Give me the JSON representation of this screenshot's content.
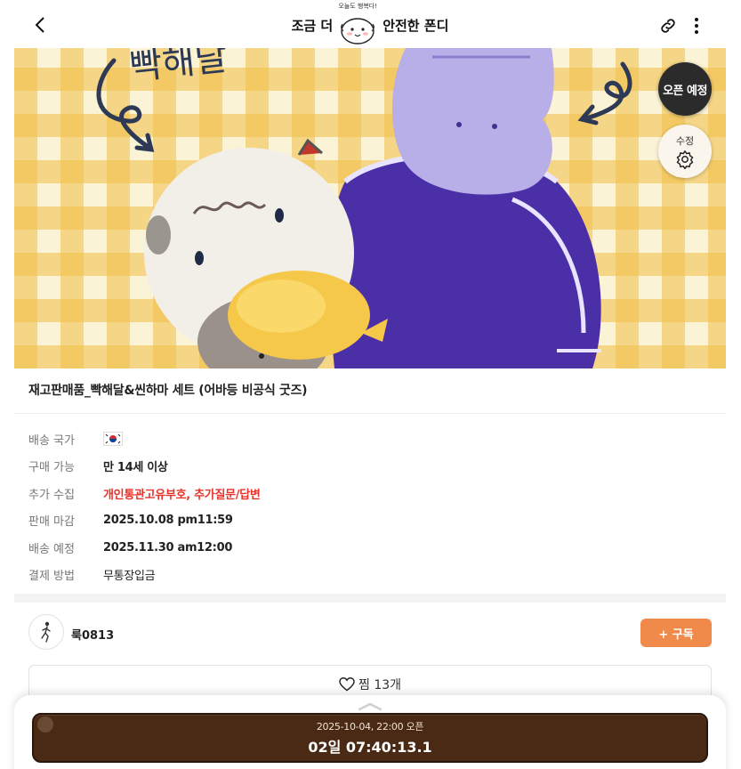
{
  "header": {
    "brand_left": "조금 더",
    "brand_right": "안전한 폰디",
    "mascot_tagline": "오늘도 행복다!",
    "icons": [
      "chevron-left-icon",
      "link-icon",
      "more-vertical-icon"
    ]
  },
  "hero": {
    "caption_handwriting": "빡해달",
    "open_badge": "오픈 예정",
    "edit_label": "수정"
  },
  "product": {
    "title": "재고판매품_빡해달&씬하마 세트 (어바등 비공식 굿즈)"
  },
  "info": [
    {
      "label": "배송 국가",
      "value": "",
      "type": "flag"
    },
    {
      "label": "구매 가능",
      "value": "만 14세 이상",
      "type": "bold"
    },
    {
      "label": "추가 수집",
      "value": "개인통관고유부호, 추가질문/답변",
      "type": "red"
    },
    {
      "label": "판매 마감",
      "value": "2025.10.08 pm11:59",
      "type": "bold"
    },
    {
      "label": "배송 예정",
      "value": "2025.11.30 am12:00",
      "type": "bold"
    },
    {
      "label": "결제 방법",
      "value": "무통장입금",
      "type": "plain"
    }
  ],
  "seller": {
    "name": "룩0813",
    "subscribe_label": "+ 구독"
  },
  "like": {
    "label": "찜 13개"
  },
  "countdown": {
    "open_at": "2025-10-04, 22:00 오픈",
    "remaining": "02일 07:40:13.1"
  },
  "colors": {
    "accent_orange": "#f08a4b",
    "alert_red": "#e8332c",
    "countdown_brown": "#4a2a14",
    "badge_dark": "#2b2b2b"
  }
}
